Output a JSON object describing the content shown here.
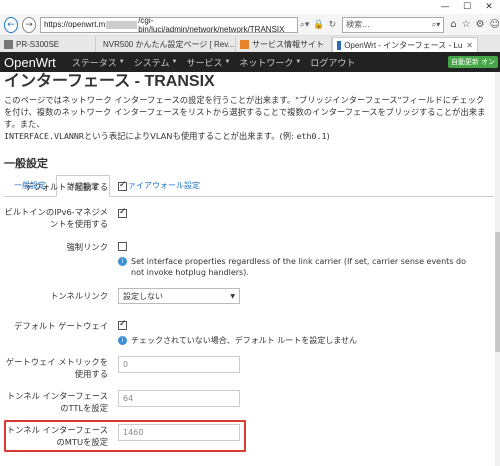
{
  "browser": {
    "url_prefix": "https://openwrt.m",
    "url_suffix": "/cgi-bin/luci/admin/network/network/TRANSIX",
    "search_placeholder": "検索...",
    "tabs": [
      {
        "label": "PR-S300SE",
        "active": false
      },
      {
        "label": "NVR500 かんたん設定ページ [ Rev...",
        "active": false
      },
      {
        "label": "サービス情報サイト",
        "active": false
      },
      {
        "label": "OpenWrt - インターフェース - Lu",
        "active": true
      }
    ]
  },
  "navbar": {
    "brand": "OpenWrt",
    "menus": [
      "ステータス",
      "システム",
      "サービス",
      "ネットワーク",
      "ログアウト"
    ],
    "auto_refresh": "自動更新 オン"
  },
  "page": {
    "title": "インターフェース - TRANSIX",
    "desc1": "このページではネットワーク インターフェースの設定を行うことが出来ます。\"ブリッジインターフェース\"フィールドにチェックを付け、複数のネットワーク インターフェースをリストから選択することで複数のインターフェースをブリッジすることが出来ます。また、",
    "desc2_mono": "INTERFACE.VLANNR",
    "desc2_mid": "という表記によりVLANも使用することが出来ます。(例: ",
    "desc2_mono2": "eth0.1",
    "desc2_end": ")"
  },
  "section": {
    "title": "一般設定",
    "tabs": [
      "一般設定",
      "詳細設定",
      "ファイアウォール設定"
    ],
    "active_tab": 1
  },
  "form": {
    "autostart_label": "デフォルトで起動する",
    "ipv6_label": "ビルトインのIPv6-マネジメントを使用する",
    "force_link_label": "強制リンク",
    "force_link_help": "Set interface properties regardless of the link carrier (If set, carrier sense events do not invoke hotplug handlers).",
    "tunnel_link_label": "トンネルリンク",
    "tunnel_link_value": "設定しない",
    "default_gw_label": "デフォルト ゲートウェイ",
    "default_gw_help": "チェックされていない場合、デフォルト ルートを設定しません",
    "metric_label": "ゲートウェイ メトリックを使用する",
    "metric_value": "0",
    "ttl_label": "トンネル インターフェースのTTLを設定",
    "ttl_value": "64",
    "mtu_label": "トンネル インターフェースのMTUを設定",
    "mtu_value": "1460"
  }
}
